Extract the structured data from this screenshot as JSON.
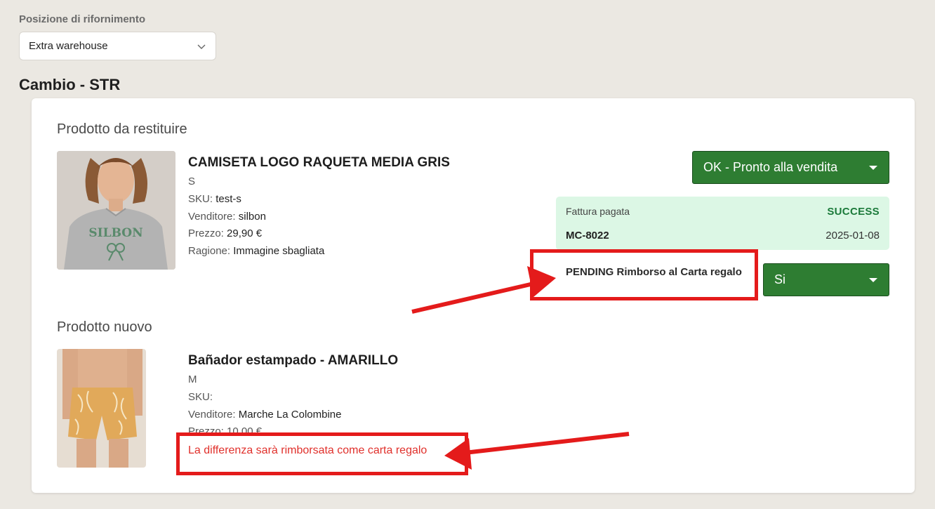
{
  "restock": {
    "label": "Posizione di rifornimento",
    "selected": "Extra warehouse"
  },
  "section_title": "Cambio - STR",
  "return_product": {
    "heading": "Prodotto da restituire",
    "name": "CAMISETA LOGO RAQUETA MEDIA GRIS",
    "size": "S",
    "sku_label": "SKU:",
    "sku": "test-s",
    "vendor_label": "Venditore:",
    "vendor": "silbon",
    "price_label": "Prezzo:",
    "price": "29,90 €",
    "reason_label": "Ragione:",
    "reason": "Immagine sbagliata",
    "shirt_print": "SILBON"
  },
  "condition_select": {
    "selected": "OK - Pronto alla vendita"
  },
  "invoice": {
    "label": "Fattura pagata",
    "status": "SUCCESS",
    "number": "MC-8022",
    "date": "2025-01-08"
  },
  "refund": {
    "text": "PENDING Rimborso al Carta regalo",
    "selected": "Si"
  },
  "new_product": {
    "heading": "Prodotto nuovo",
    "name": "Bañador estampado - AMARILLO",
    "size": "M",
    "sku_label": "SKU:",
    "sku": "",
    "vendor_label": "Venditore:",
    "vendor": "Marche La Colombine",
    "price_partial": "Prezzo: 10,00 €",
    "difference_note": "La differenza sarà rimborsata come carta regalo"
  },
  "colors": {
    "background": "#ebe8e2",
    "green_button": "#2e7d32",
    "invoice_bg": "#dcf7e5",
    "success_text": "#1b7a3a",
    "annotation_red": "#e41b1b",
    "note_red": "#e0302b"
  },
  "icons": {
    "select_chevron": "chevron-down-icon",
    "dropdown_caret": "caret-down-icon",
    "annotation_arrow": "arrow-icon"
  }
}
